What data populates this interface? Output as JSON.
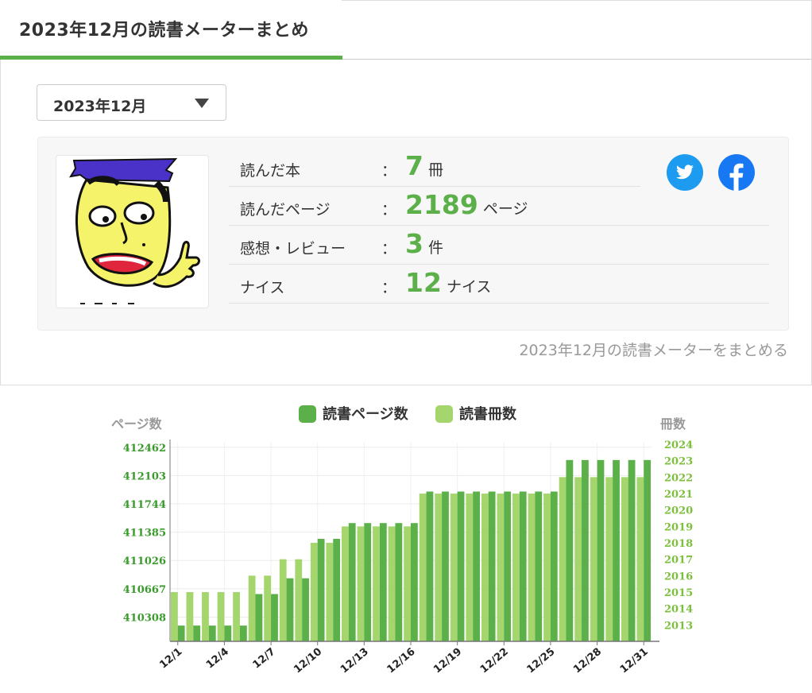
{
  "page": {
    "title": "2023年12月の読書メーターまとめ"
  },
  "month_select": {
    "selected": "2023年12月"
  },
  "avatar": {
    "name": "user-avatar-illustration"
  },
  "stats": [
    {
      "label": "読んだ本",
      "value": "7",
      "unit": "冊"
    },
    {
      "label": "読んだページ",
      "value": "2189",
      "unit": "ページ"
    },
    {
      "label": "感想・レビュー",
      "value": "3",
      "unit": "件"
    },
    {
      "label": "ナイス",
      "value": "12",
      "unit": "ナイス"
    }
  ],
  "colon": "：",
  "share": {
    "twitter_icon": "twitter-icon",
    "facebook_icon": "facebook-icon"
  },
  "summarize_link": "2023年12月の読書メーターをまとめる",
  "colors": {
    "accent": "#5cb04a",
    "pages_bar": "#5cb04a",
    "books_bar": "#a5d66d",
    "twitter": "#1d9bf0",
    "facebook": "#1877f2"
  },
  "chart_data": {
    "type": "bar",
    "y_left_label": "ページ数",
    "y_right_label": "冊数",
    "legend_position": "top",
    "grid": true,
    "categories": [
      "12/1",
      "12/2",
      "12/3",
      "12/4",
      "12/5",
      "12/6",
      "12/7",
      "12/8",
      "12/9",
      "12/10",
      "12/11",
      "12/12",
      "12/13",
      "12/14",
      "12/15",
      "12/16",
      "12/17",
      "12/18",
      "12/19",
      "12/20",
      "12/21",
      "12/22",
      "12/23",
      "12/24",
      "12/25",
      "12/26",
      "12/27",
      "12/28",
      "12/29",
      "12/30",
      "12/31"
    ],
    "x_tick_labels": [
      "12/1",
      "12/4",
      "12/7",
      "12/10",
      "12/13",
      "12/16",
      "12/19",
      "12/22",
      "12/25",
      "12/28",
      "12/31"
    ],
    "y_left_ticks": [
      "412462",
      "412103",
      "411744",
      "411385",
      "411026",
      "410667",
      "410308"
    ],
    "y_left_range": [
      410000,
      412520
    ],
    "y_right_ticks": [
      "2024",
      "2023",
      "2022",
      "2021",
      "2020",
      "2019",
      "2018",
      "2017",
      "2016",
      "2015",
      "2014",
      "2013"
    ],
    "y_right_range": [
      2012,
      2024.1
    ],
    "series": [
      {
        "name": "読書ページ数",
        "axis": "left",
        "values": [
          410200,
          410200,
          410200,
          410200,
          410200,
          410600,
          410600,
          410800,
          410800,
          411300,
          411300,
          411500,
          411500,
          411500,
          411500,
          411500,
          411900,
          411900,
          411900,
          411900,
          411900,
          411900,
          411900,
          411900,
          411900,
          412300,
          412300,
          412300,
          412300,
          412300,
          412300
        ]
      },
      {
        "name": "読書冊数",
        "axis": "right",
        "values": [
          2015,
          2015,
          2015,
          2015,
          2015,
          2016,
          2016,
          2017,
          2017,
          2018,
          2018,
          2019,
          2019,
          2019,
          2019,
          2019,
          2021,
          2021,
          2021,
          2021,
          2021,
          2021,
          2021,
          2021,
          2021,
          2022,
          2022,
          2022,
          2022,
          2022,
          2022
        ]
      }
    ]
  }
}
